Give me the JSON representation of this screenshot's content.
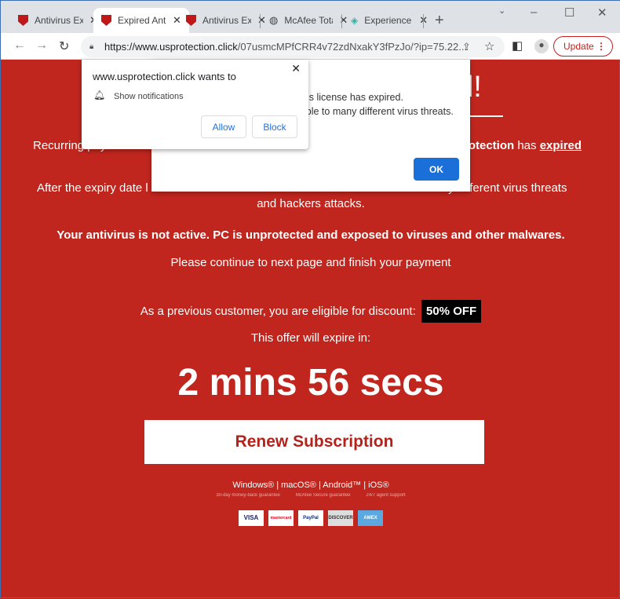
{
  "browser": {
    "tabs": [
      {
        "label": "Antivirus Expired",
        "icon": "mcafee-shield-icon"
      },
      {
        "label": "Expired Antivirus",
        "icon": "mcafee-shield-icon",
        "active": true
      },
      {
        "label": "Antivirus Expired",
        "icon": "mcafee-shield-icon"
      },
      {
        "label": "McAfee Total",
        "icon": "globe-icon"
      },
      {
        "label": "Experience",
        "icon": "diamond-icon"
      }
    ],
    "url_host": "https://www.usprotection.click",
    "url_path": "/07usmcMPfCRR4v72zdNxakY3fPzJo/?ip=75.22...",
    "update_label": "Update"
  },
  "notification": {
    "title": "www.usprotection.click wants to",
    "permission": "Show notifications",
    "allow": "Allow",
    "block": "Block"
  },
  "alert": {
    "line1": "d antivirus license has expired.",
    "line2": "ible to many different virus threats.",
    "ok": "OK"
  },
  "page": {
    "heading_fragment": "ed!",
    "recurring_left": "Recurring payment",
    "recurring_right_bold": "rotection",
    "recurring_right_mid": " has ",
    "recurring_right_link": "expired",
    "expiry_left": "After the expiry date l",
    "expiry_right": "y different virus threats",
    "expiry_line2": "and hackers attacks.",
    "warning": "Your antivirus is not active. PC is unprotected and exposed to viruses and other malwares.",
    "continue": "Please continue to next page and finish your payment",
    "discount_text": "As a previous customer, you are eligible for discount:",
    "discount_badge": "50% OFF",
    "expire_in": "This offer will expire in:",
    "countdown": "2 mins 56 secs",
    "renew": "Renew Subscription",
    "platforms": "Windows® | macOS® | Android™ | iOS®",
    "guarantees": [
      "30-day money-back guarantee",
      "McAfee Secure guarantee",
      "24/7 agent support"
    ],
    "payments": [
      "VISA",
      "mastercard",
      "PayPal",
      "DISCOVER",
      "AMEX"
    ]
  },
  "colors": {
    "background": "#c0261e",
    "renew_text": "#b3221b",
    "ok_button": "#1a6fd8"
  }
}
